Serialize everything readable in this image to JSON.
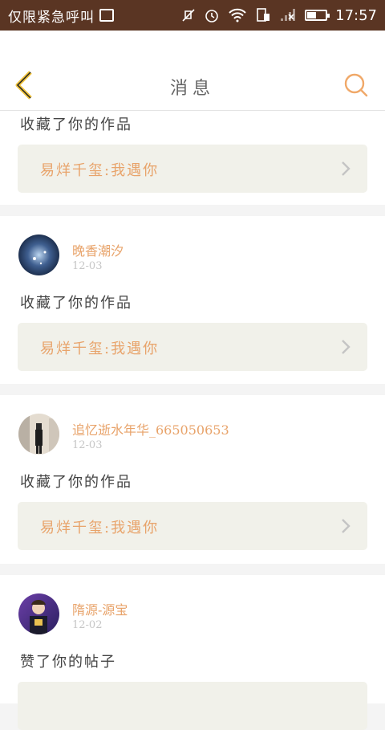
{
  "status_bar": {
    "carrier": "仅限紧急呼叫",
    "time": "17:57",
    "battery_level": 0.5,
    "icons": [
      "gallery-icon",
      "mute-icon",
      "alarm-icon",
      "wifi-icon",
      "sim-icon",
      "signal-icon",
      "battery-icon"
    ]
  },
  "header": {
    "title": "消息",
    "back_icon": "chevron-left-icon",
    "search_icon": "search-icon",
    "accent_color": "#f0c33c"
  },
  "colors": {
    "brand_brown": "#5a3523",
    "link_orange": "#e8a36a",
    "box_bg": "#f1f1ea"
  },
  "messages": [
    {
      "action": "收藏了你的作品",
      "work_title": "易烊千玺:我遇你"
    },
    {
      "username": "晚香潮汐",
      "date": "12-03",
      "action": "收藏了你的作品",
      "work_title": "易烊千玺:我遇你"
    },
    {
      "username": "追忆逝水年华_665050653",
      "date": "12-03",
      "action": "收藏了你的作品",
      "work_title": "易烊千玺:我遇你"
    },
    {
      "username": "隋源-源宝",
      "date": "12-02",
      "action": "赞了你的帖子"
    }
  ]
}
